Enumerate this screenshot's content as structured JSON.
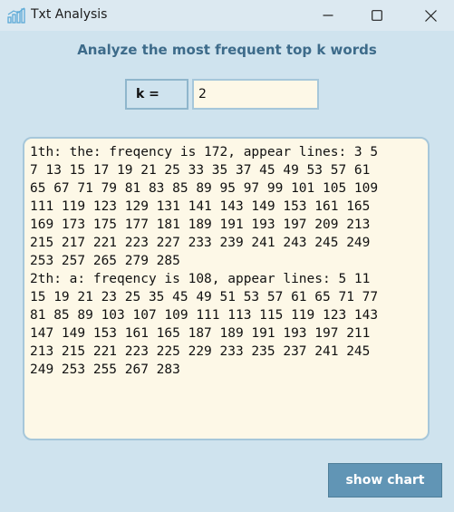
{
  "window": {
    "title": "Txt Analysis",
    "icon": "bar-chart-app-icon",
    "controls": [
      "minimize-icon",
      "maximize-icon",
      "close-icon"
    ]
  },
  "main": {
    "heading": "Analyze the most frequent top k words",
    "k_label": "k =",
    "k_value": "2",
    "output_lines": [
      "1th: the: freqency is 172, appear lines: 3 5",
      "7 13 15 17 19 21 25 33 35 37 45 49 53 57 61",
      "65 67 71 79 81 83 85 89 95 97 99 101 105 109",
      "111 119 123 129 131 141 143 149 153 161 165",
      "169 173 175 177 181 189 191 193 197 209 213",
      "215 217 221 223 227 233 239 241 243 245 249",
      "253 257 265 279 285",
      "2th: a: freqency is 108, appear lines: 5 11",
      "15 19 21 23 25 35 45 49 51 53 57 61 65 71 77",
      "81 85 89 103 107 109 111 113 115 119 123 143",
      "147 149 153 161 165 187 189 191 193 197 211",
      "213 215 221 223 225 229 233 235 237 241 245",
      "249 253 255 267 283"
    ],
    "chart_button_label": "show chart"
  },
  "colors": {
    "background": "#cfe3ee",
    "accent": "#6195b5",
    "heading": "#3d6b8a",
    "field_background": "#fdf8e7"
  }
}
